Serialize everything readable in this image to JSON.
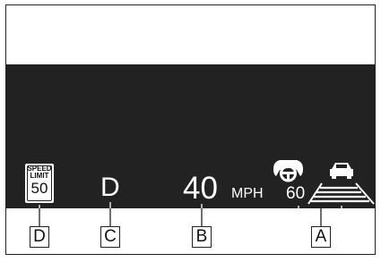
{
  "speed_limit_sign": {
    "line1": "SPEED",
    "line2": "LIMIT",
    "value": "50"
  },
  "gear_position": "D",
  "vehicle_speed": {
    "value": "40",
    "unit": "MPH"
  },
  "cruise_control": {
    "set_speed": "60",
    "steering_icon": "steering-wheel-icon",
    "vehicle_icon": "preceding-vehicle-icon",
    "distance_bars": 3
  },
  "callouts": {
    "a": "A",
    "b": "B",
    "c": "C",
    "d": "D"
  },
  "colors": {
    "display_background": "#222222",
    "display_text": "#ffffff",
    "page_background": "#ffffff"
  }
}
